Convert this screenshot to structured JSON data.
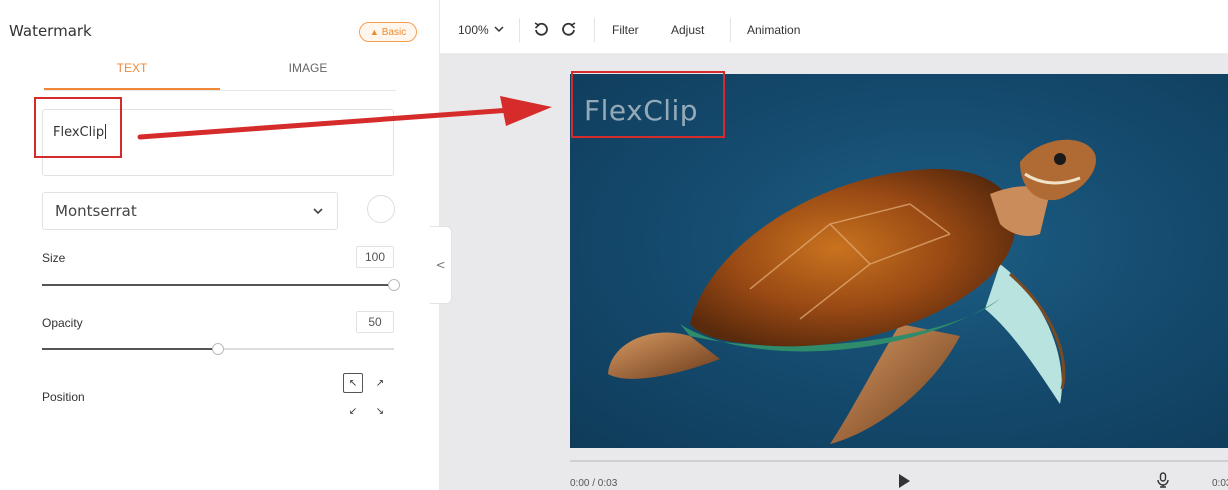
{
  "panel": {
    "title": "Watermark",
    "badge": "Basic",
    "tabs": [
      {
        "label": "TEXT",
        "active": true
      },
      {
        "label": "IMAGE",
        "active": false
      }
    ],
    "watermark_text": "FlexClip",
    "font": {
      "selected": "Montserrat"
    },
    "size": {
      "label": "Size",
      "value": "100",
      "level": 1.0
    },
    "opacity": {
      "label": "Opacity",
      "value": "50",
      "level": 0.5
    },
    "position": {
      "label": "Position",
      "selected": "top-left"
    }
  },
  "toolbar": {
    "zoom": "100%",
    "filter": "Filter",
    "adjust": "Adjust",
    "animation": "Animation"
  },
  "player": {
    "watermark_preview": "FlexClip",
    "time": "0:00 / 0:03",
    "end_time": "0:03"
  },
  "colors": {
    "accent": "#f0883a",
    "annotation_red": "#d62b2b",
    "video_bg": "#154c70"
  }
}
